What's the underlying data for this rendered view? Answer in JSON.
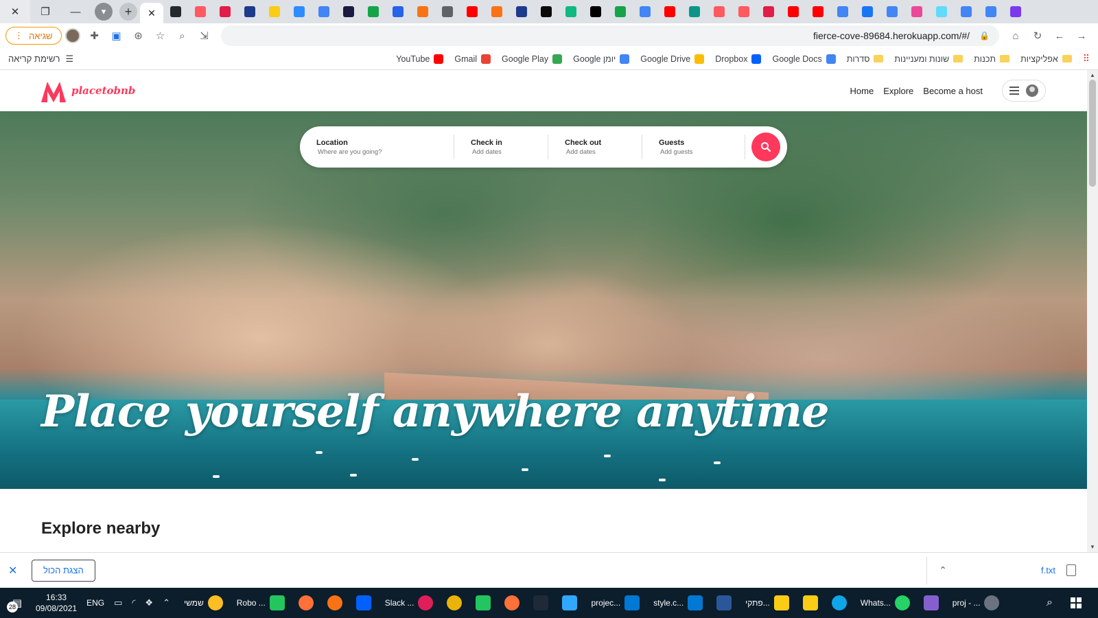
{
  "browser": {
    "error_pill": "שגיאה",
    "url": "fierce-cove-89684.herokuapp.com/#/",
    "reading_list": "רשימת קריאה",
    "pinned_tab_colors": [
      "#24292e",
      "#ff5a5f",
      "#e11d48",
      "#1e3a8a",
      "#facc15",
      "#2d8cff",
      "#4285f4",
      "#1a1a40",
      "#16a34a",
      "#2563eb",
      "#f97316",
      "#5f6368",
      "#ff0000",
      "#f97316",
      "#1e3a8a",
      "#0a0a0a",
      "#10b981",
      "#000000",
      "#16a34a",
      "#4285f4",
      "#ff0000",
      "#0d9488",
      "#ff5a5f",
      "#ff5a5f",
      "#e11d48",
      "#ff0000",
      "#ff0000",
      "#4285f4",
      "#1877f2",
      "#4285f4",
      "#ec4899",
      "#61dafb",
      "#4285f4",
      "#4285f4",
      "#7c3aed"
    ],
    "bookmarks": [
      {
        "label": "YouTube",
        "color": "#ff0000"
      },
      {
        "label": "Gmail",
        "color": "#ea4335"
      },
      {
        "label": "Google Play",
        "color": "#34a853"
      },
      {
        "label": "Google יומן",
        "color": "#4285f4"
      },
      {
        "label": "Google Drive",
        "color": "#fbbc04"
      },
      {
        "label": "Dropbox",
        "color": "#0061ff"
      },
      {
        "label": "Google Docs",
        "color": "#4285f4"
      }
    ],
    "folders": [
      "סדרות",
      "שונות ומעניינות",
      "תכנות",
      "אפליקציות"
    ]
  },
  "site": {
    "brand": "placetobnb",
    "brand_color": "#ff385c",
    "nav": [
      "Home",
      "Explore",
      "Become a host"
    ],
    "search": {
      "location_label": "Location",
      "location_placeholder": "Where are you going?",
      "checkin_label": "Check in",
      "checkin_placeholder": "Add dates",
      "checkout_label": "Check out",
      "checkout_placeholder": "Add dates",
      "guests_label": "Guests",
      "guests_placeholder": "Add guests"
    },
    "hero_title": "Place yourself anywhere anytime",
    "section_title": "Explore nearby"
  },
  "downloads": {
    "show_all": "הצגת הכול",
    "file": "f.txt"
  },
  "taskbar": {
    "notifications": "28",
    "time": "16:33",
    "date": "09/08/2021",
    "lang": "ENG",
    "apps": [
      {
        "label": "שמשי",
        "color": "#fbbf24",
        "round": true
      },
      {
        "label": "Robo ...",
        "color": "#22c55e",
        "round": false
      },
      {
        "label": "",
        "color": "#ff7139",
        "round": true
      },
      {
        "label": "",
        "color": "#f97316",
        "round": true
      },
      {
        "label": "",
        "color": "#0061ff",
        "round": false
      },
      {
        "label": "Slack ...",
        "color": "#e01e5a",
        "round": true
      },
      {
        "label": "",
        "color": "#eab308",
        "round": true
      },
      {
        "label": "",
        "color": "#22c55e",
        "round": false
      },
      {
        "label": "",
        "color": "#ff7139",
        "round": true
      },
      {
        "label": "",
        "color": "#1f2937",
        "round": false
      },
      {
        "label": "",
        "color": "#31a8ff",
        "round": false
      },
      {
        "label": "projec...",
        "color": "#0078d4",
        "round": false
      },
      {
        "label": "style.c...",
        "color": "#0078d4",
        "round": false
      },
      {
        "label": "",
        "color": "#2b579a",
        "round": false
      },
      {
        "label": "פתקי...",
        "color": "#facc15",
        "round": false
      },
      {
        "label": "",
        "color": "#facc15",
        "round": false
      },
      {
        "label": "",
        "color": "#0ea5e9",
        "round": true
      },
      {
        "label": "Whats...",
        "color": "#25d366",
        "round": true
      },
      {
        "label": "",
        "color": "#865fcf",
        "round": false
      },
      {
        "label": "proj - ...",
        "color": "#6b7280",
        "round": true
      }
    ]
  }
}
